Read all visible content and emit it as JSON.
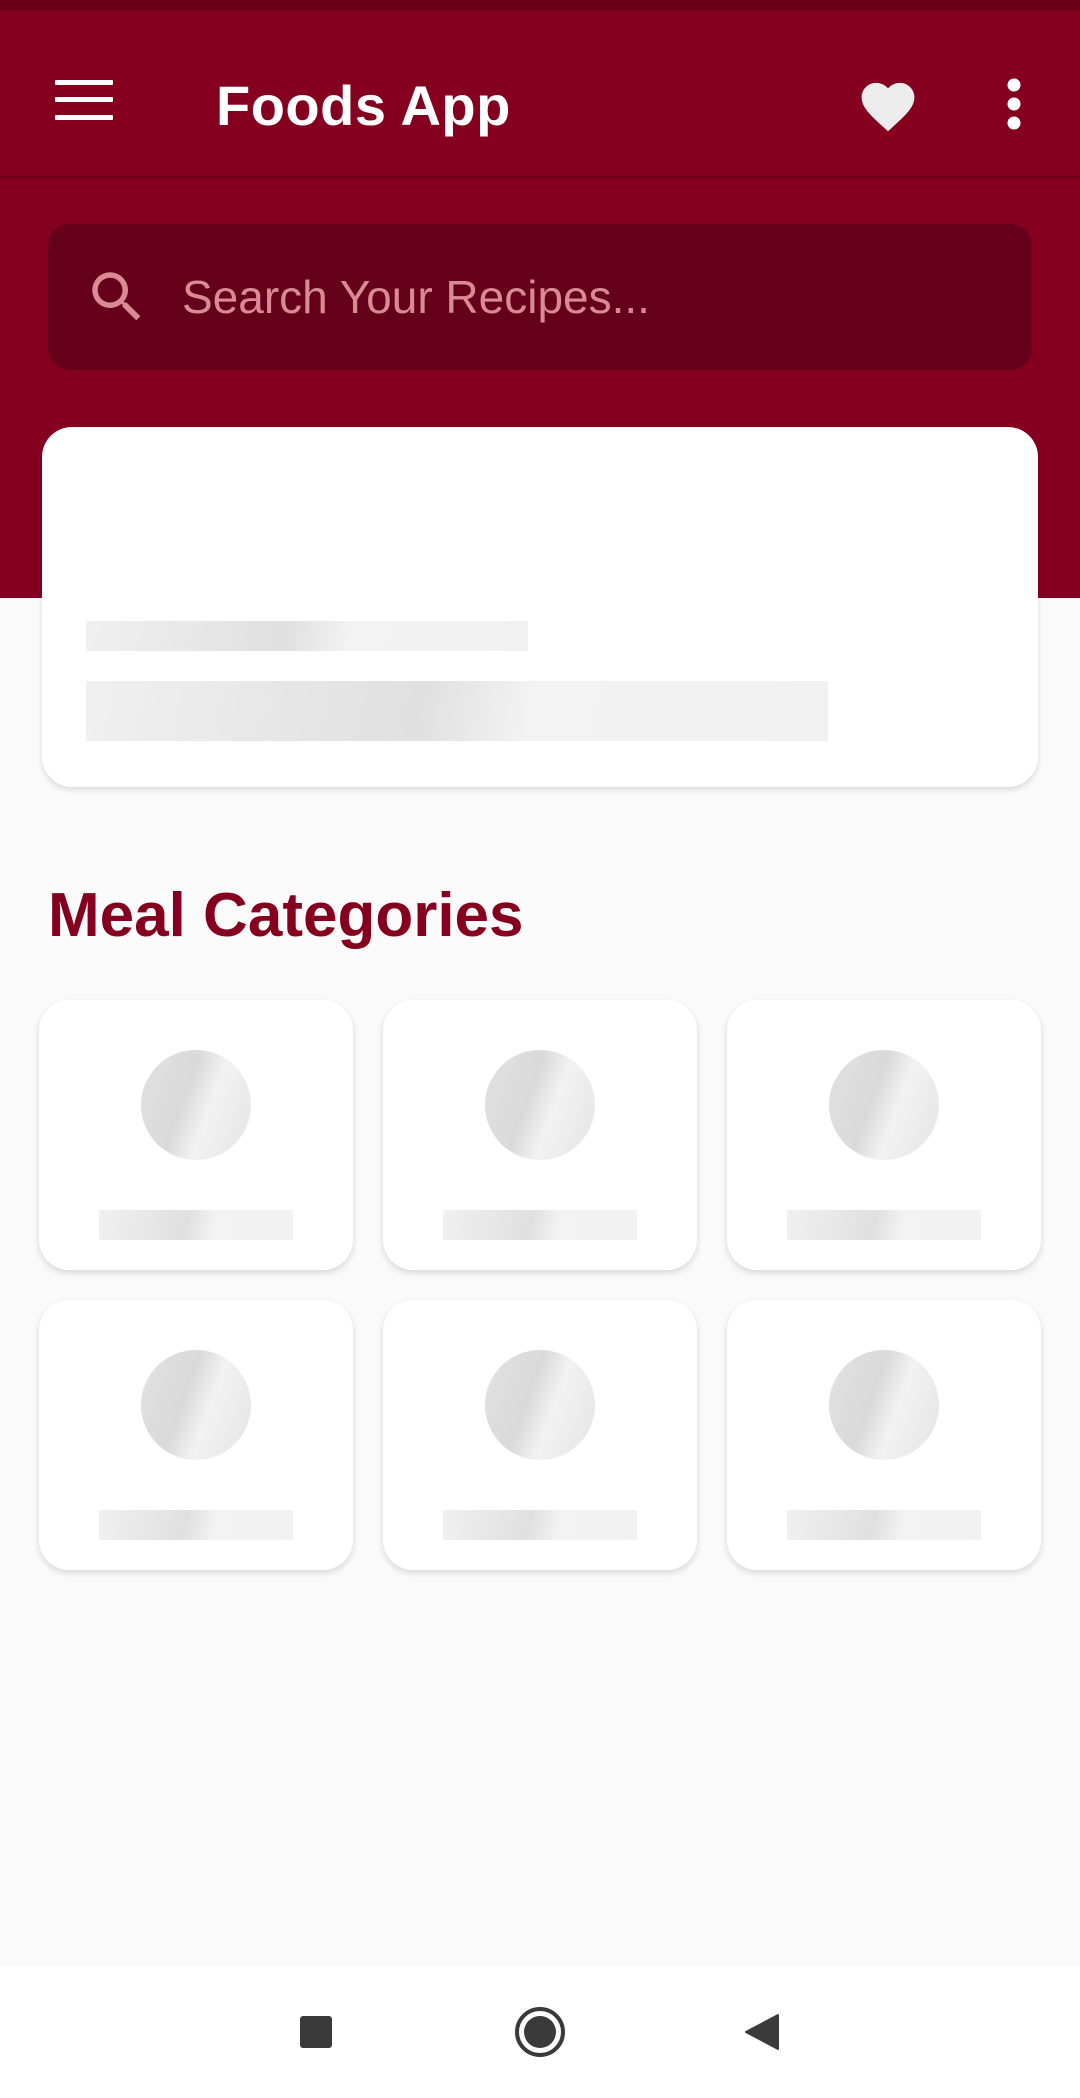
{
  "app": {
    "title": "Foods App",
    "accent_color": "#85001f",
    "dark_accent_color": "#65001a"
  },
  "toolbar": {
    "menu_icon": "hamburger-menu-icon",
    "favorites_icon": "heart-icon",
    "more_icon": "more-vert-icon"
  },
  "search": {
    "placeholder": "Search Your Recipes...",
    "value": "",
    "icon": "search-icon"
  },
  "sections": {
    "categories_title": "Meal Categories"
  },
  "categories": {
    "placeholder_count": 6
  },
  "system_nav": {
    "recents_icon": "square-icon",
    "home_icon": "circle-icon",
    "back_icon": "triangle-back-icon"
  }
}
